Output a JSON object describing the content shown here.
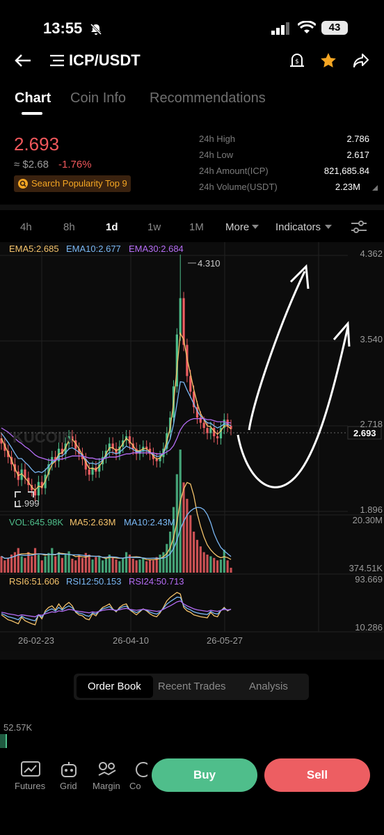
{
  "status": {
    "time": "13:55",
    "battery": "43"
  },
  "nav": {
    "pair": "ICP/USDT"
  },
  "tabs": [
    "Chart",
    "Coin Info",
    "Recommendations"
  ],
  "ticker": {
    "price": "2.693",
    "usd_price": "≈ $2.68",
    "change": "-1.76%",
    "popularity": "Search Popularity Top 9",
    "stats": [
      {
        "label": "24h High",
        "value": "2.786"
      },
      {
        "label": "24h Low",
        "value": "2.617"
      },
      {
        "label": "24h Amount(ICP)",
        "value": "821,685.84"
      },
      {
        "label": "24h Volume(USDT)",
        "value": "2.23M"
      }
    ]
  },
  "timeframes": [
    "4h",
    "8h",
    "1d",
    "1w",
    "1M",
    "More",
    "Indicators"
  ],
  "chart_data": {
    "type": "candlestick",
    "pair": "ICP/USDT",
    "interval": "1d",
    "ema": {
      "ema5": "EMA5:2.685",
      "ema10": "EMA10:2.677",
      "ema30": "EMA30:2.684"
    },
    "price_axis": [
      "4.362",
      "3.540",
      "2.718",
      "1.896"
    ],
    "current_price_label": "2.693",
    "high_marker": "4.310",
    "low_marker": "1.999",
    "volume": {
      "vol": "VOL:645.98K",
      "ma5": "MA5:2.63M",
      "ma10": "MA10:2.43M",
      "axis_top": "20.30M",
      "axis_bottom": "374.51K"
    },
    "rsi": {
      "rsi6": "RSI6:51.606",
      "rsi12": "RSI12:50.153",
      "rsi24": "RSI24:50.713",
      "axis_top": "93.669",
      "axis_bottom": "10.286"
    },
    "dates": [
      "26-02-23",
      "26-04-10",
      "26-05-27"
    ],
    "closes": [
      2.55,
      2.48,
      2.42,
      2.35,
      2.28,
      2.2,
      2.3,
      2.22,
      2.15,
      2.1,
      2.05,
      2.18,
      2.12,
      2.25,
      2.35,
      2.42,
      2.38,
      2.5,
      2.45,
      2.55,
      2.62,
      2.58,
      2.5,
      2.45,
      2.4,
      2.3,
      2.25,
      2.32,
      2.28,
      2.35,
      2.42,
      2.48,
      2.55,
      2.5,
      2.45,
      2.52,
      2.58,
      2.62,
      2.55,
      2.5,
      2.45,
      2.48,
      2.52,
      2.5,
      2.45,
      2.4,
      2.38,
      2.42,
      2.5,
      2.65,
      2.8,
      3.1,
      3.6,
      3.95,
      3.5,
      3.2,
      3.05,
      2.9,
      2.8,
      2.75,
      2.7,
      2.65,
      2.7,
      2.62,
      2.6,
      2.7,
      2.78,
      2.72,
      2.69
    ],
    "ema5_series": [
      2.6,
      2.53,
      2.46,
      2.39,
      2.31,
      2.24,
      2.26,
      2.22,
      2.18,
      2.13,
      2.1,
      2.14,
      2.13,
      2.19,
      2.27,
      2.35,
      2.38,
      2.45,
      2.46,
      2.51,
      2.58,
      2.59,
      2.55,
      2.5,
      2.44,
      2.37,
      2.31,
      2.31,
      2.3,
      2.33,
      2.38,
      2.45,
      2.51,
      2.51,
      2.48,
      2.5,
      2.55,
      2.6,
      2.57,
      2.53,
      2.48,
      2.48,
      2.5,
      2.5,
      2.47,
      2.43,
      2.4,
      2.41,
      2.46,
      2.57,
      2.7,
      2.94,
      3.27,
      3.61,
      3.55,
      3.37,
      3.22,
      3.07,
      2.94,
      2.84,
      2.78,
      2.72,
      2.71,
      2.67,
      2.64,
      2.67,
      2.72,
      2.72,
      2.69
    ],
    "ema30_series": [
      2.7,
      2.68,
      2.66,
      2.63,
      2.6,
      2.57,
      2.55,
      2.52,
      2.5,
      2.47,
      2.44,
      2.42,
      2.41,
      2.4,
      2.39,
      2.39,
      2.39,
      2.4,
      2.4,
      2.41,
      2.42,
      2.43,
      2.43,
      2.43,
      2.43,
      2.42,
      2.41,
      2.41,
      2.4,
      2.4,
      2.4,
      2.41,
      2.42,
      2.42,
      2.42,
      2.43,
      2.44,
      2.45,
      2.45,
      2.46,
      2.46,
      2.46,
      2.46,
      2.46,
      2.46,
      2.46,
      2.45,
      2.45,
      2.45,
      2.47,
      2.49,
      2.53,
      2.6,
      2.68,
      2.73,
      2.76,
      2.78,
      2.79,
      2.79,
      2.79,
      2.79,
      2.78,
      2.78,
      2.77,
      2.76,
      2.76,
      2.76,
      2.75,
      2.75
    ],
    "volumes": [
      2,
      1.5,
      1.8,
      2.2,
      2.5,
      3,
      2,
      1.8,
      2.5,
      2,
      3,
      2.2,
      1.5,
      2,
      2.4,
      3,
      2,
      2.5,
      1.8,
      2.2,
      2.6,
      1.7,
      1.5,
      2.1,
      1.8,
      2.4,
      2.2,
      1.6,
      1.9,
      2,
      1.5,
      1.7,
      2.2,
      1.9,
      1.6,
      1.4,
      1.8,
      2.5,
      2.2,
      1.7,
      1.5,
      1.6,
      1.8,
      1.4,
      1.6,
      1.5,
      1.9,
      2.2,
      2.5,
      3.5,
      5,
      8,
      12,
      15,
      11,
      9,
      7,
      5,
      4,
      3.2,
      2.5,
      2.2,
      2,
      1.8,
      1.5,
      1.6,
      2.8,
      1.5,
      0.6
    ],
    "rsi6_series": [
      40,
      35,
      30,
      28,
      25,
      22,
      35,
      28,
      25,
      22,
      20,
      40,
      32,
      48,
      55,
      58,
      50,
      62,
      52,
      60,
      65,
      58,
      45,
      40,
      38,
      32,
      30,
      42,
      38,
      48,
      55,
      58,
      62,
      52,
      46,
      55,
      60,
      62,
      50,
      45,
      40,
      46,
      52,
      48,
      42,
      38,
      36,
      44,
      55,
      68,
      75,
      80,
      85,
      82,
      55,
      48,
      45,
      40,
      38,
      36,
      35,
      34,
      45,
      38,
      36,
      48,
      55,
      48,
      51.6
    ],
    "rsi24_series": [
      45,
      44,
      42,
      41,
      40,
      38,
      40,
      39,
      38,
      37,
      36,
      40,
      39,
      42,
      44,
      46,
      45,
      48,
      47,
      49,
      51,
      50,
      48,
      47,
      46,
      45,
      44,
      46,
      45,
      47,
      49,
      50,
      51,
      50,
      49,
      50,
      52,
      53,
      51,
      50,
      49,
      50,
      51,
      50,
      49,
      48,
      47,
      48,
      51,
      55,
      58,
      62,
      66,
      68,
      62,
      58,
      55,
      52,
      50,
      49,
      48,
      47,
      49,
      48,
      47,
      49,
      51,
      50,
      50.7
    ]
  },
  "orderbook_tabs": [
    "Order Book",
    "Recent Trades",
    "Analysis"
  ],
  "depth_label": "52.57K",
  "dock": {
    "items": [
      "Futures",
      "Grid",
      "Margin",
      "Co"
    ],
    "buy": "Buy",
    "sell": "Sell"
  },
  "colors": {
    "up": "#4fbe8b",
    "down": "#ed5e62",
    "ema5": "#f5c36b",
    "ema10": "#7ab8f5",
    "ema30": "#b56cf5",
    "accent": "#f5a623"
  }
}
